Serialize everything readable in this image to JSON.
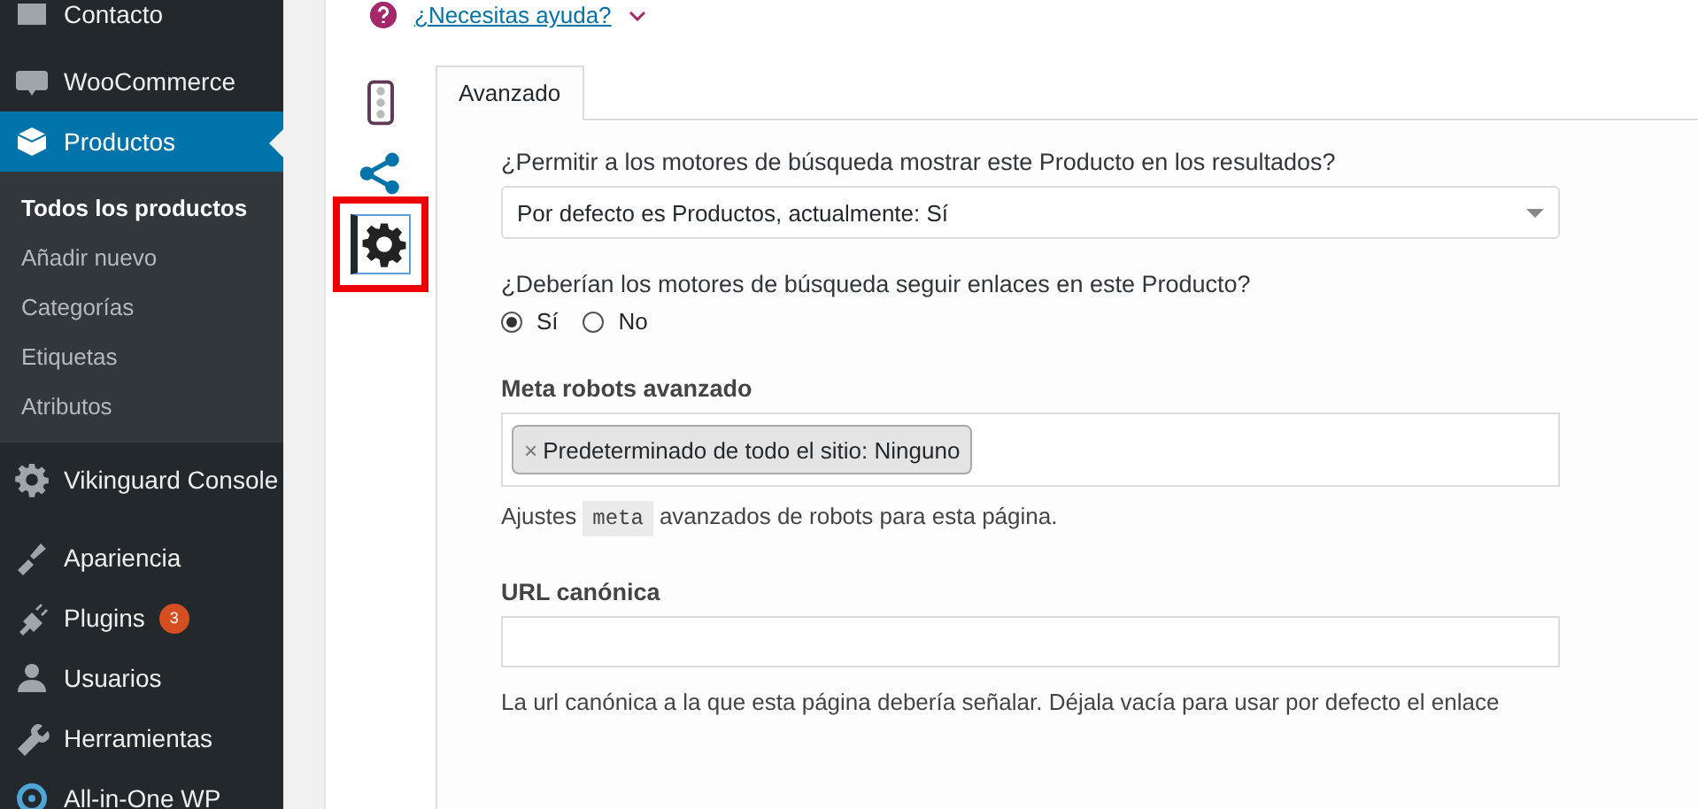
{
  "sidebar": {
    "items": [
      {
        "label": "Contacto",
        "selected": false
      },
      {
        "label": "WooCommerce",
        "selected": false
      },
      {
        "label": "Productos",
        "selected": true,
        "children": [
          {
            "label": "Todos los productos",
            "selected": true
          },
          {
            "label": "Añadir nuevo",
            "selected": false
          },
          {
            "label": "Categorías",
            "selected": false
          },
          {
            "label": "Etiquetas",
            "selected": false
          },
          {
            "label": "Atributos",
            "selected": false
          }
        ]
      },
      {
        "label": "Vikinguard Console",
        "selected": false
      },
      {
        "label": "Apariencia",
        "selected": false
      },
      {
        "label": "Plugins",
        "selected": false,
        "badge": "3"
      },
      {
        "label": "Usuarios",
        "selected": false
      },
      {
        "label": "Herramientas",
        "selected": false
      },
      {
        "label": "All-in-One WP",
        "selected": false
      }
    ]
  },
  "help": {
    "link": "¿Necesitas ayuda?"
  },
  "side_tabs": [
    {
      "kind": "traffic",
      "selected": false,
      "highlighted": false
    },
    {
      "kind": "share",
      "selected": false,
      "highlighted": false
    },
    {
      "kind": "gear",
      "selected": true,
      "highlighted": true
    }
  ],
  "tabs": [
    {
      "label": "Avanzado",
      "selected": true
    }
  ],
  "fields": [
    {
      "kind": "select",
      "label": "¿Permitir a los motores de búsqueda mostrar este Producto en los resultados?",
      "value": "Por defecto es Productos, actualmente: Sí"
    },
    {
      "kind": "radios",
      "label": "¿Deberían los motores de búsqueda seguir enlaces en este Producto?",
      "options": [
        {
          "label": "Sí",
          "selected": true
        },
        {
          "label": "No",
          "selected": false
        }
      ]
    },
    {
      "kind": "tags",
      "label": "Meta robots avanzado",
      "tags": [
        {
          "remove": "×",
          "label": "Predeterminado de todo el sitio: Ninguno"
        }
      ],
      "help": [
        {
          "kind": "text",
          "text": "Ajustes"
        },
        {
          "kind": "code",
          "text": "meta"
        },
        {
          "kind": "text",
          "text": "avanzados de robots para esta página."
        }
      ]
    },
    {
      "kind": "text",
      "label": "URL canónica",
      "help": [
        {
          "kind": "text",
          "text": "La url canónica a la que esta página debería señalar. Déjala vacía para usar por defecto el enlace"
        }
      ]
    }
  ]
}
